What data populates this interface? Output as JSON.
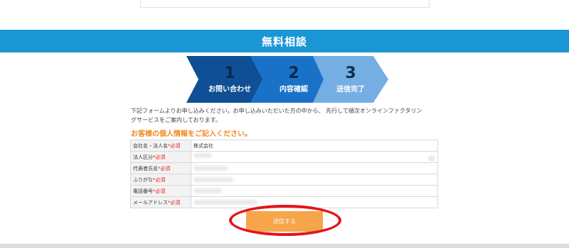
{
  "banner": {
    "title": "無料相談"
  },
  "steps": [
    {
      "num": "1",
      "label": "お問い合わせ"
    },
    {
      "num": "2",
      "label": "内容確認"
    },
    {
      "num": "3",
      "label": "送信完了"
    }
  ],
  "intro": {
    "line1": "下記フォームよりお申し込みください。お申し込みいただいた方の中から、 先行して順次オンラインファクタリン",
    "line2": "グサービスをご案内しております。"
  },
  "form_heading": "お客様の個人情報をご記入ください。",
  "form": {
    "required_mark": "*必須",
    "rows": [
      {
        "label": "会社名・法人名",
        "value": "株式会社"
      },
      {
        "label": "法人区分",
        "value": ""
      },
      {
        "label": "代表者氏名",
        "value": ""
      },
      {
        "label": "ふりがな",
        "value": ""
      },
      {
        "label": "電話番号",
        "value": ""
      },
      {
        "label": "メールアドレス",
        "value": ""
      }
    ]
  },
  "submit_label": "送信する",
  "colors": {
    "banner": "#1a96d4",
    "step1": "#0f4f95",
    "step2": "#1a72c8",
    "step3": "#74aee3",
    "heading": "#f08a1c",
    "required": "#e02020",
    "submit": "#f6a54a",
    "highlight_circle": "#e3141b"
  }
}
